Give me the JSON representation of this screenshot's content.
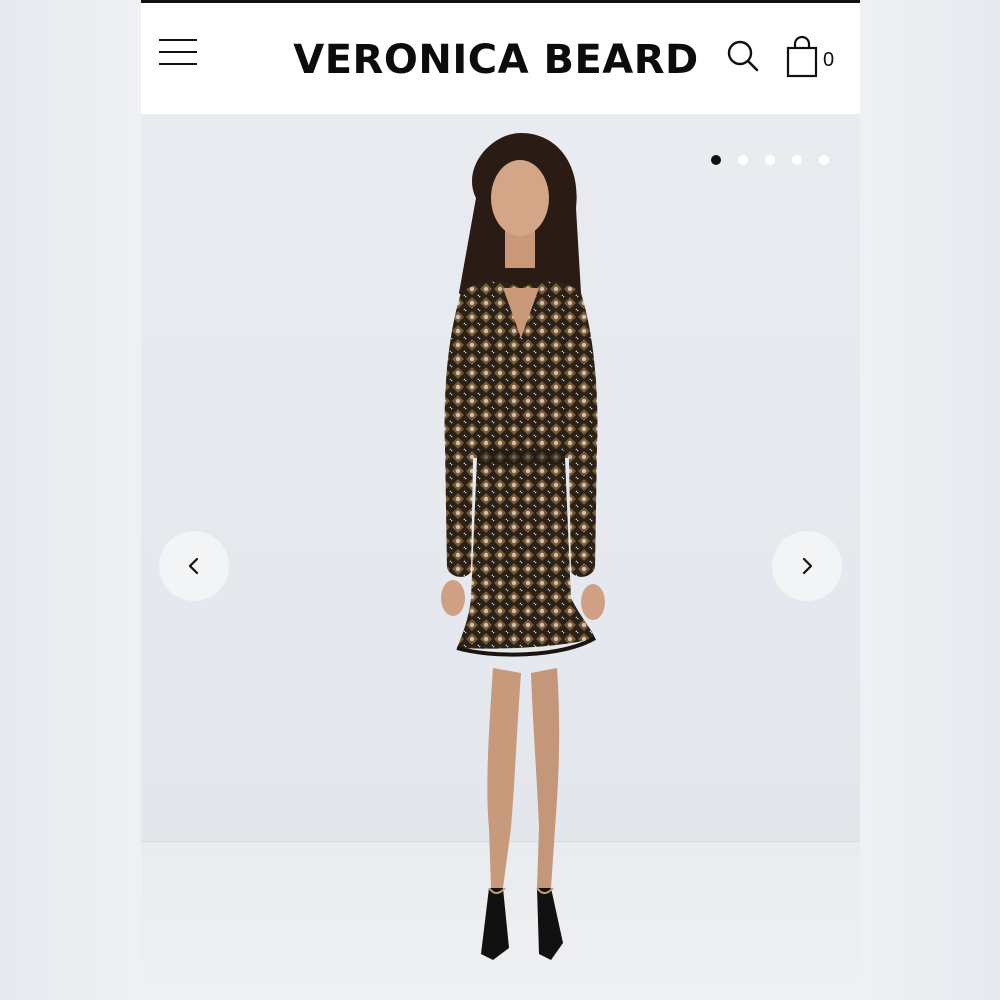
{
  "header": {
    "brand": "VERONICA BEARD",
    "cart_count": "0",
    "icons": {
      "menu": "hamburger-menu-icon",
      "search": "search-icon",
      "cart": "shopping-bag-icon"
    }
  },
  "gallery": {
    "slide_count": 5,
    "active_slide": 1,
    "icons": {
      "prev": "chevron-left-icon",
      "next": "chevron-right-icon"
    }
  },
  "colors": {
    "header_bg": "#ffffff",
    "text": "#111111",
    "hero_bg": "#e8ebf0",
    "dot_active": "#111111",
    "dot_inactive": "#ffffff"
  }
}
